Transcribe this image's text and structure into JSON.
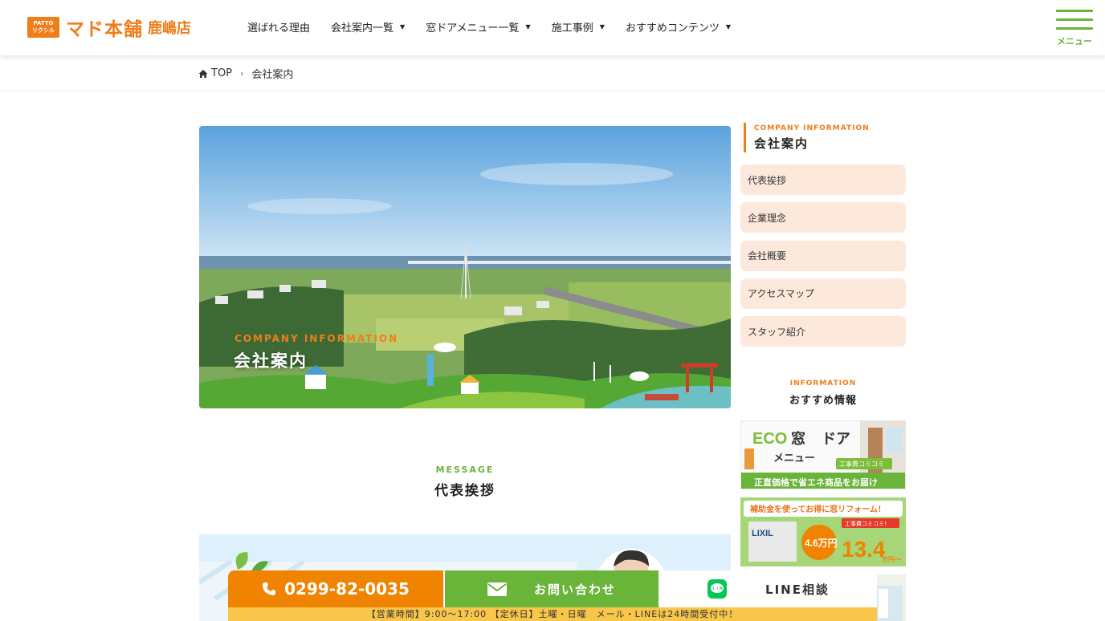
{
  "header": {
    "logo_badge_top": "PATTO",
    "logo_badge_bottom": "リクシル",
    "logo_main": "マド本舗",
    "logo_sub": "鹿嶋店",
    "nav": [
      {
        "label": "選ばれる理由",
        "has_dropdown": false
      },
      {
        "label": "会社案内一覧",
        "has_dropdown": true
      },
      {
        "label": "窓ドアメニュー一覧",
        "has_dropdown": true
      },
      {
        "label": "施工事例",
        "has_dropdown": true
      },
      {
        "label": "おすすめコンテンツ",
        "has_dropdown": true
      }
    ],
    "menu_label": "メニュー"
  },
  "breadcrumb": {
    "home": "TOP",
    "current": "会社案内"
  },
  "hero": {
    "title_en": "COMPANY INFORMATION",
    "title_ja": "会社案内"
  },
  "message": {
    "en": "MESSAGE",
    "ja": "代表挨拶"
  },
  "sidebar": {
    "head_en": "COMPANY INFORMATION",
    "head_ja": "会社案内",
    "links": [
      {
        "label": "代表挨拶"
      },
      {
        "label": "企業理念"
      },
      {
        "label": "会社概要"
      },
      {
        "label": "アクセスマップ"
      },
      {
        "label": "スタッフ紹介"
      }
    ],
    "info_en": "INFORMATION",
    "info_ja": "おすすめ情報",
    "banner1": {
      "title_a": "ECO",
      "title_b": "窓",
      "title_c": "ドア",
      "line2": "メニュー",
      "tag": "工事費コミコミ",
      "footer": "正直価格で省エネ商品をお届け"
    },
    "banner2": {
      "title": "補助金を使ってお得に窓リフォーム！",
      "brand": "LIXIL",
      "badge": "工事費コミコミ！",
      "subsidy": "4.6万円",
      "price": "13.4",
      "unit": "万円〜"
    }
  },
  "cta": {
    "phone": "0299-82-0035",
    "mail": "お問い合わせ",
    "line": "LINE相談",
    "hours": "【営業時間】9:00～17:00 【定休日】土曜・日曜　メール・LINEは24時間受付中！"
  },
  "colors": {
    "brand_orange": "#ef7d1a",
    "green": "#6ab43a",
    "sidebar_link_bg": "#fde9dc",
    "hours_bar": "#f7c64a"
  }
}
